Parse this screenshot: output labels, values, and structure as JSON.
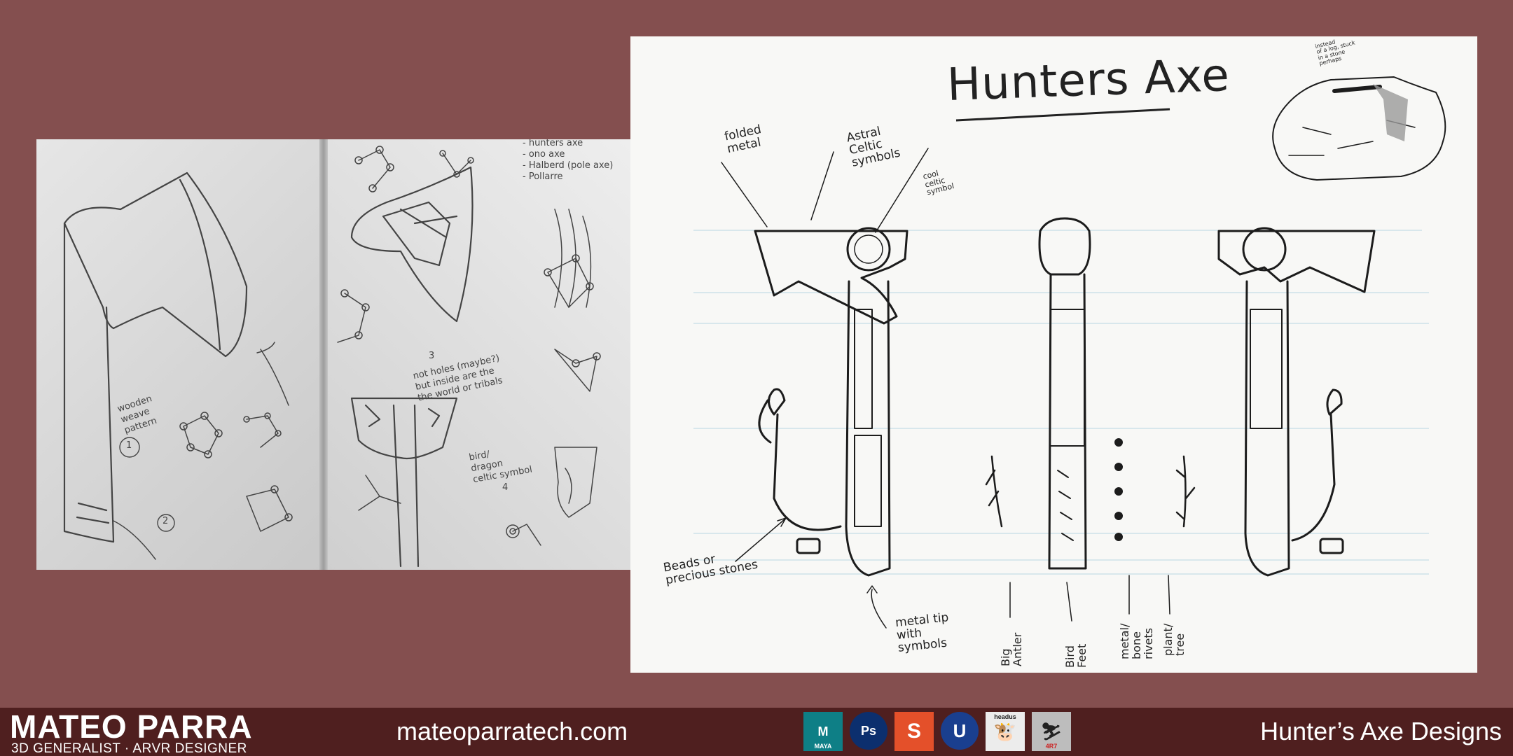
{
  "sketchbook": {
    "notes_list": "- hunters axe\n- ono axe\n- Halberd (pole axe)\n- Pollarre",
    "note_wooden": "wooden\nweave\npattern",
    "note_holes": "not holes (maybe?)\nbut inside are the\nthe world or tribals",
    "note_bird": "bird/\ndragon\nceltic symbol",
    "num_1": "1",
    "num_2": "2",
    "num_3": "3",
    "num_4": "4"
  },
  "sheet": {
    "title": "Hunters Axe",
    "label_folded": "folded\nmetal",
    "label_astral": "Astral\nCeltic\nsymbols",
    "label_cool": "cool\nceltic\nsymbol",
    "label_beads": "Beads or\nprecious stones",
    "label_metal_tip": "metal tip\nwith\nsymbols",
    "label_big_antler": "Big\nAntler",
    "label_bird_feet": "Bird\nFeet",
    "label_rivets": "metal/\nbone\nrivets",
    "label_plant": "plant/\ntree",
    "label_sketch_note": "instead\nof a log, stuck\nin a stone\nperhaps"
  },
  "footer": {
    "brand_name": "MATEO PARRA",
    "brand_sub": "3D GENERALIST · ARVR DESIGNER",
    "website": "mateoparratech.com",
    "title": "Hunter’s Axe Designs",
    "tools": [
      {
        "name": "maya-icon",
        "caption": "MAYA",
        "color": "#0e7f86",
        "glyph": "M"
      },
      {
        "name": "photoshop-icon",
        "caption": "",
        "color": "#0c2f6e",
        "glyph": "Ps"
      },
      {
        "name": "substance-icon",
        "caption": "",
        "color": "#e4502a",
        "glyph": "S"
      },
      {
        "name": "unreal-icon",
        "caption": "",
        "color": "#1a3f8f",
        "glyph": "U"
      },
      {
        "name": "headus-icon",
        "caption": "headus",
        "color": "#ececec",
        "glyph": "🐮"
      },
      {
        "name": "zbrush-icon",
        "caption": "4R7",
        "color": "#bdbdbd",
        "glyph": "⛷"
      }
    ]
  }
}
